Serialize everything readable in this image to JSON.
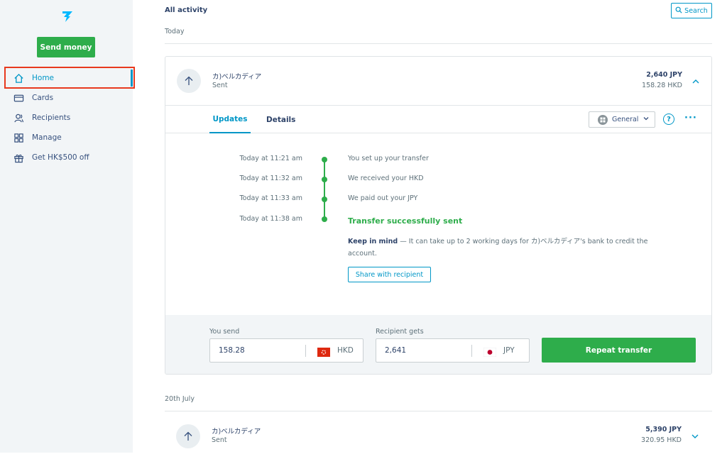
{
  "sidebar": {
    "logo_icon": "wise-flag-icon",
    "send_money_label": "Send money",
    "items": [
      {
        "label": "Home",
        "icon": "home-icon"
      },
      {
        "label": "Cards",
        "icon": "card-icon"
      },
      {
        "label": "Recipients",
        "icon": "recipients-icon"
      },
      {
        "label": "Manage",
        "icon": "grid-icon"
      },
      {
        "label": "Get HK$500 off",
        "icon": "gift-icon"
      }
    ]
  },
  "main": {
    "heading": "All activity",
    "search_label": "Search",
    "today_label": "Today",
    "second_day_label": "20th July",
    "expanded_tx": {
      "name": "カ)ベルカディア",
      "status": "Sent",
      "amount": "2,640 JPY",
      "sub_amount": "158.28 HKD",
      "tabs": [
        "Updates",
        "Details"
      ],
      "category_label": "General",
      "help_icon": "question-icon",
      "more_icon": "more-icon",
      "timeline": [
        {
          "time": "Today at 11:21 am",
          "text": "You set up your transfer"
        },
        {
          "time": "Today at 11:32 am",
          "text": "We received your HKD"
        },
        {
          "time": "Today at 11:33 am",
          "text": "We paid out your JPY"
        },
        {
          "time": "Today at 11:38 am",
          "text": "Transfer successfully sent"
        }
      ],
      "keep_in_mind_bold": "Keep in mind",
      "keep_in_mind_text": " — It can take up to 2 working days for カ)ベルカディア's bank to credit the account.",
      "share_label": "Share with recipient",
      "you_send_label": "You send",
      "you_send_value": "158.28",
      "you_send_currency": "HKD",
      "recipient_gets_label": "Recipient gets",
      "recipient_gets_value": "2,641",
      "recipient_gets_currency": "JPY",
      "repeat_label": "Repeat transfer"
    },
    "second_tx": {
      "name": "カ)ベルカディア",
      "status": "Sent",
      "amount": "5,390 JPY",
      "sub_amount": "320.95 HKD"
    }
  },
  "colors": {
    "accent": "#0097c7",
    "green": "#2ead4b",
    "highlight": "#e8391e"
  }
}
